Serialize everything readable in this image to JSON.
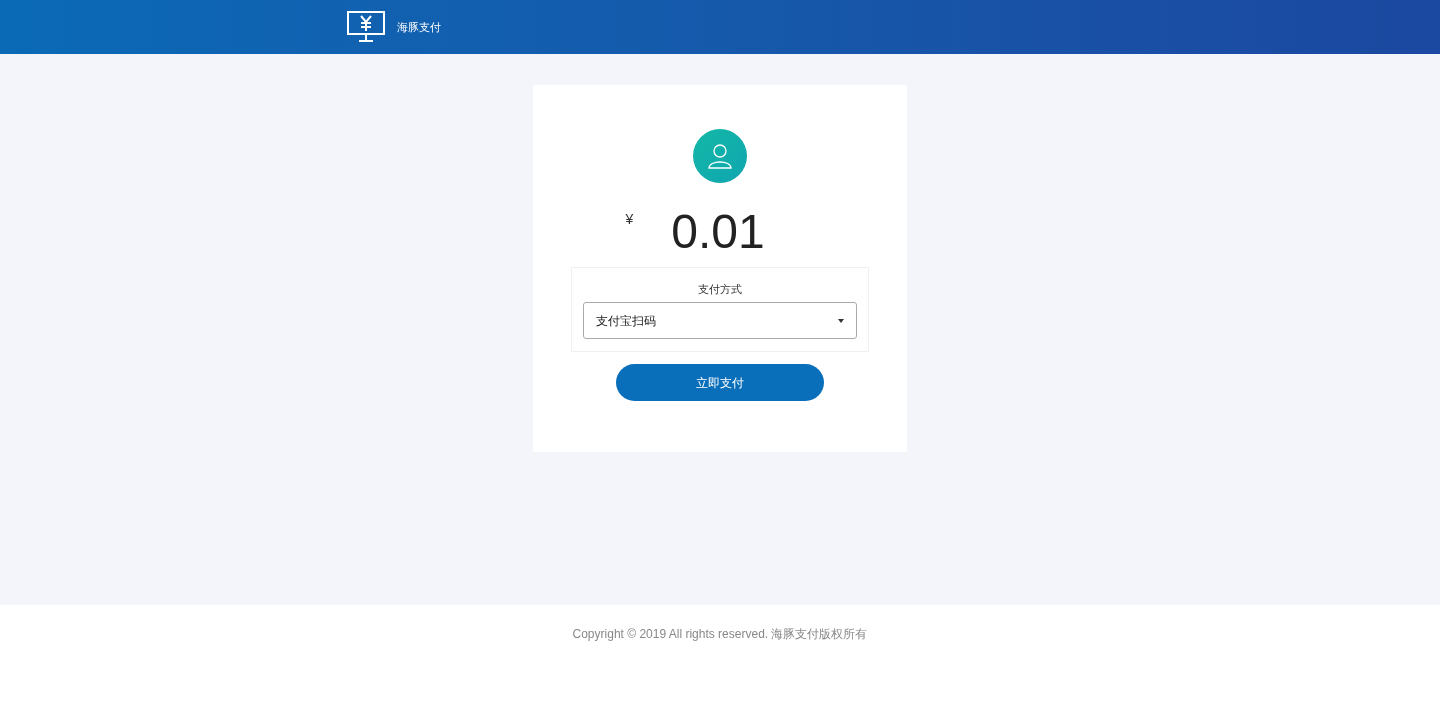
{
  "header": {
    "brand": "海豚支付"
  },
  "payment": {
    "currency": "¥",
    "amount": "0.01",
    "method_label": "支付方式",
    "method_value": "支付宝扫码",
    "pay_button": "立即支付"
  },
  "footer": {
    "copyright": "Copyright © 2019 All rights reserved. 海豚支付版权所有"
  }
}
